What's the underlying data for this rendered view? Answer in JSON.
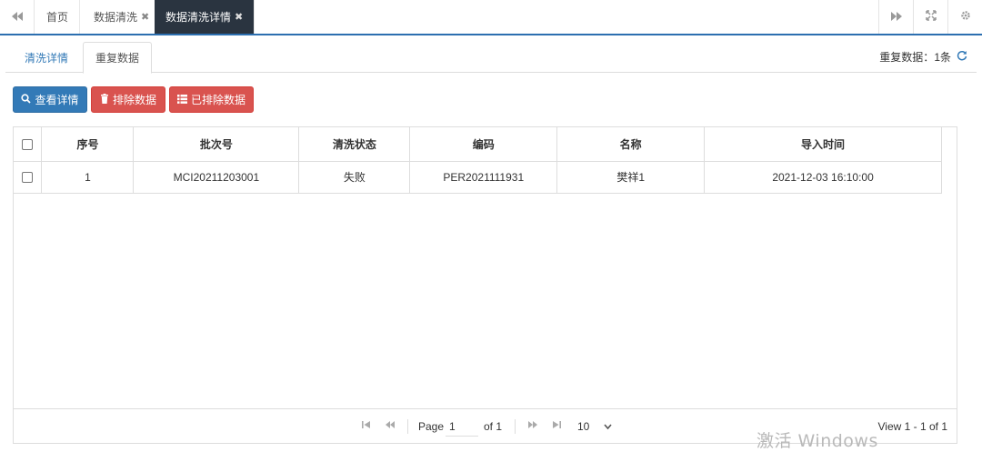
{
  "topbar": {
    "back_icon": "double-chevron-left-icon",
    "tabs": [
      {
        "label": "首页",
        "closable": false
      },
      {
        "label": "数据清洗",
        "closable": true
      },
      {
        "label": "数据清洗详情",
        "closable": true
      }
    ],
    "close_glyph": "✖",
    "forward_icon": "double-chevron-right-icon",
    "fullscreen_icon": "expand-icon",
    "settings_icon": "gear-icon"
  },
  "subtabs": {
    "items": [
      "清洗详情",
      "重复数据"
    ],
    "active": "重复数据"
  },
  "dup_info": {
    "label": "重复数据：",
    "count": "1条",
    "refresh_icon": "refresh-icon"
  },
  "actions": {
    "view_label": "查看详情",
    "exclude_label": "排除数据",
    "excluded_label": "已排除数据",
    "colors": {
      "primary": "#337ab7",
      "danger": "#d9534f"
    }
  },
  "table": {
    "headers": [
      "序号",
      "批次号",
      "清洗状态",
      "编码",
      "名称",
      "导入时间"
    ],
    "rows": [
      [
        "1",
        "MCI20211203001",
        "失败",
        "PER2021111931",
        "樊祥1",
        "2021-12-03 16:10:00"
      ]
    ]
  },
  "pager": {
    "page_label": "Page",
    "page_value": "1",
    "of_label": "of 1",
    "rows_per_page": "10",
    "view_text": "View 1 - 1 of 1"
  },
  "watermark": "激活 Windows"
}
